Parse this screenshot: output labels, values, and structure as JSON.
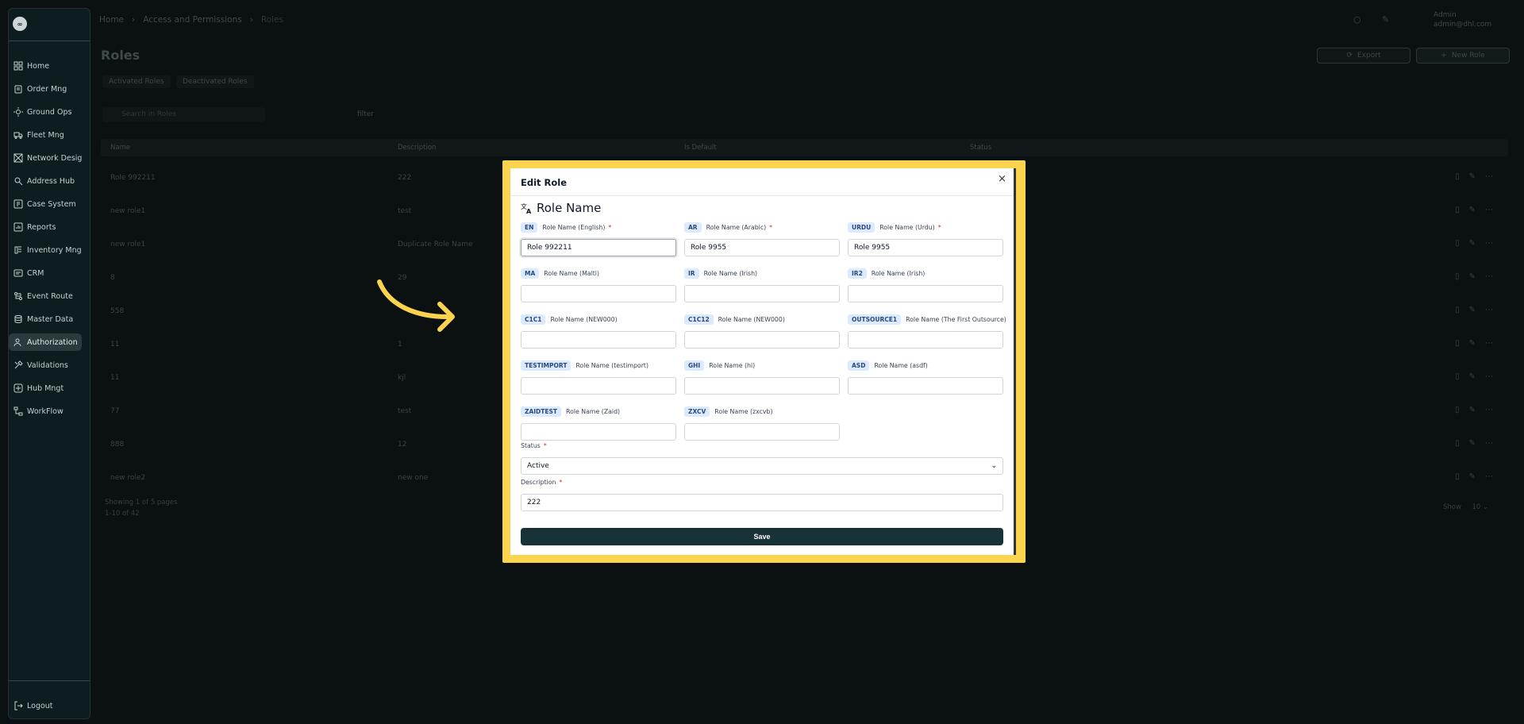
{
  "sidebar": {
    "logo": "∞",
    "items": [
      {
        "label": "Home",
        "icon": "grid-icon",
        "active": false
      },
      {
        "label": "Order Mng",
        "icon": "clipboard-icon",
        "active": false
      },
      {
        "label": "Ground Ops",
        "icon": "sun-icon",
        "active": false
      },
      {
        "label": "Fleet Mng",
        "icon": "truck-icon",
        "active": false
      },
      {
        "label": "Network Design",
        "icon": "network-icon",
        "active": false
      },
      {
        "label": "Address Hub",
        "icon": "pin-icon",
        "active": false
      },
      {
        "label": "Case System",
        "icon": "case-icon",
        "active": false
      },
      {
        "label": "Reports",
        "icon": "report-icon",
        "active": false
      },
      {
        "label": "Inventory Mng",
        "icon": "inventory-icon",
        "active": false
      },
      {
        "label": "CRM",
        "icon": "crm-icon",
        "active": false
      },
      {
        "label": "Event Route",
        "icon": "route-icon",
        "active": false
      },
      {
        "label": "Master Data",
        "icon": "database-icon",
        "active": false
      },
      {
        "label": "Authorization",
        "icon": "users-icon",
        "active": true
      },
      {
        "label": "Validations",
        "icon": "tools-icon",
        "active": false
      },
      {
        "label": "Hub Mngt",
        "icon": "hub-icon",
        "active": false
      },
      {
        "label": "WorkFlow",
        "icon": "workflow-icon",
        "active": false
      }
    ],
    "logout": "Logout"
  },
  "header": {
    "breadcrumb": [
      "Home",
      "Access and Permissions",
      "Roles"
    ],
    "user_name": "Admin",
    "user_email": "admin@dhl.com"
  },
  "page": {
    "title": "Roles",
    "export_label": "Export",
    "new_role_label": "New Role",
    "tabs": [
      "Activated Roles",
      "Deactivated Roles"
    ],
    "search_placeholder": "Search in Roles",
    "filter_label": "filter",
    "columns": [
      "Name",
      "Description",
      "Is Default",
      "Status"
    ],
    "rows": [
      {
        "name": "Role 992211",
        "description": "222"
      },
      {
        "name": "new role1",
        "description": "test"
      },
      {
        "name": "new role1",
        "description": "Duplicate Role Name"
      },
      {
        "name": "8",
        "description": "29"
      },
      {
        "name": "558",
        "description": ""
      },
      {
        "name": "11",
        "description": "1"
      },
      {
        "name": "11",
        "description": "kjl"
      },
      {
        "name": "77",
        "description": "test"
      },
      {
        "name": "888",
        "description": "12"
      },
      {
        "name": "new role2",
        "description": "new one"
      }
    ],
    "pager_line1": "Showing 1 of 5 pages",
    "pager_line2": "1-10 of 42",
    "show_label": "Show",
    "show_value": "10"
  },
  "modal": {
    "title": "Edit Role",
    "close": "×",
    "section_title": "Role Name",
    "fields": [
      {
        "code": "EN",
        "label": "Role Name (English)",
        "required": true,
        "value": "Role 992211"
      },
      {
        "code": "AR",
        "label": "Role Name (Arabic)",
        "required": true,
        "value": "Role 9955"
      },
      {
        "code": "URDU",
        "label": "Role Name (Urdu)",
        "required": true,
        "value": "Role 9955"
      },
      {
        "code": "MA",
        "label": "Role Name (Malti)",
        "required": false,
        "value": ""
      },
      {
        "code": "IR",
        "label": "Role Name (Irish)",
        "required": false,
        "value": ""
      },
      {
        "code": "IR2",
        "label": "Role Name (Irish)",
        "required": false,
        "value": ""
      },
      {
        "code": "C1C1",
        "label": "Role Name (NEW000)",
        "required": false,
        "value": ""
      },
      {
        "code": "C1C12",
        "label": "Role Name (NEW000)",
        "required": false,
        "value": ""
      },
      {
        "code": "OUTSOURCE1",
        "label": "Role Name (The First Outsource)",
        "required": false,
        "value": ""
      },
      {
        "code": "TESTIMPORT",
        "label": "Role Name (testimport)",
        "required": false,
        "value": ""
      },
      {
        "code": "GHI",
        "label": "Role Name (hi)",
        "required": false,
        "value": ""
      },
      {
        "code": "ASD",
        "label": "Role Name (asdf)",
        "required": false,
        "value": ""
      },
      {
        "code": "ZAIDTEST",
        "label": "Role Name (Zaid)",
        "required": false,
        "value": ""
      },
      {
        "code": "ZXCV",
        "label": "Role Name (zxcvb)",
        "required": false,
        "value": ""
      }
    ],
    "status_label": "Status",
    "status_value": "Active",
    "description_label": "Description",
    "description_value": "222",
    "save_label": "Save"
  },
  "colors": {
    "highlight_frame": "#fcd34d",
    "save_button": "#173337",
    "required": "#dc2626",
    "badge_bg": "#dbeafe"
  }
}
